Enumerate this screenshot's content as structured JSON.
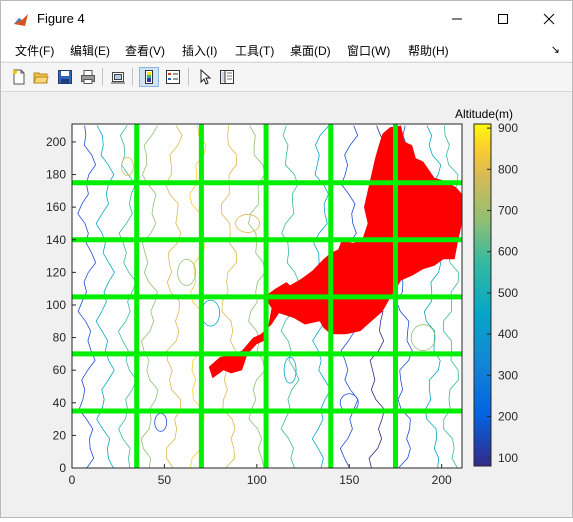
{
  "window": {
    "title": "Figure 4",
    "icon": "matlab-figure-icon"
  },
  "menu": [
    {
      "label": "文件(F)"
    },
    {
      "label": "编辑(E)"
    },
    {
      "label": "查看(V)"
    },
    {
      "label": "插入(I)"
    },
    {
      "label": "工具(T)"
    },
    {
      "label": "桌面(D)"
    },
    {
      "label": "窗口(W)"
    },
    {
      "label": "帮助(H)"
    }
  ],
  "menu_arrow": "↘",
  "toolbar": {
    "icons": [
      "new-figure-icon",
      "open-file-icon",
      "save-icon",
      "print-icon",
      "link-plot-icon",
      "colorbar-toggle-icon",
      "legend-toggle-icon",
      "edit-plot-pointer-icon",
      "property-inspector-icon"
    ],
    "active": "colorbar-toggle-icon"
  },
  "chart_data": {
    "type": "heatmap",
    "description_kind": "contour map with burned-area overlay and grid lines",
    "x_ticks": [
      "0",
      "50",
      "100",
      "150",
      "200"
    ],
    "y_ticks": [
      "0",
      "20",
      "40",
      "60",
      "80",
      "100",
      "120",
      "140",
      "160",
      "180",
      "200"
    ],
    "xlim": [
      0,
      211
    ],
    "ylim": [
      0,
      211
    ],
    "grid_lines_x": [
      35,
      70,
      105,
      140,
      175
    ],
    "grid_lines_y": [
      35,
      70,
      105,
      140,
      175
    ],
    "grid_line_color": "#00ee00",
    "fire_color": "#ff0000",
    "colorbar": {
      "title": "Altitude(m)",
      "ticks": [
        "100",
        "200",
        "300",
        "400",
        "500",
        "600",
        "700",
        "800",
        "900"
      ],
      "range": [
        80,
        910
      ],
      "colormap": "parula"
    },
    "fire_region": [
      [
        76,
        55
      ],
      [
        82,
        60
      ],
      [
        86,
        58
      ],
      [
        92,
        60
      ],
      [
        95,
        70
      ],
      [
        100,
        76
      ],
      [
        104,
        78
      ],
      [
        106,
        86
      ],
      [
        108,
        98
      ],
      [
        104,
        105
      ],
      [
        110,
        110
      ],
      [
        116,
        114
      ],
      [
        118,
        112
      ],
      [
        124,
        116
      ],
      [
        130,
        121
      ],
      [
        136,
        128
      ],
      [
        140,
        132
      ],
      [
        144,
        134
      ],
      [
        146,
        140
      ],
      [
        152,
        138
      ],
      [
        157,
        140
      ],
      [
        160,
        150
      ],
      [
        158,
        160
      ],
      [
        160,
        170
      ],
      [
        162,
        180
      ],
      [
        164,
        190
      ],
      [
        166,
        198
      ],
      [
        168,
        205
      ],
      [
        172,
        209
      ],
      [
        178,
        210
      ],
      [
        180,
        200
      ],
      [
        184,
        198
      ],
      [
        186,
        190
      ],
      [
        190,
        188
      ],
      [
        196,
        178
      ],
      [
        202,
        176
      ],
      [
        208,
        172
      ],
      [
        211,
        168
      ],
      [
        211,
        150
      ],
      [
        209,
        140
      ],
      [
        207,
        128
      ],
      [
        201,
        128
      ],
      [
        196,
        124
      ],
      [
        190,
        122
      ],
      [
        184,
        118
      ],
      [
        178,
        115
      ],
      [
        172,
        104
      ],
      [
        168,
        96
      ],
      [
        164,
        92
      ],
      [
        156,
        84
      ],
      [
        148,
        82
      ],
      [
        140,
        82
      ],
      [
        136,
        86
      ],
      [
        134,
        90
      ],
      [
        126,
        88
      ],
      [
        120,
        92
      ],
      [
        112,
        95
      ],
      [
        108,
        88
      ],
      [
        102,
        82
      ],
      [
        98,
        80
      ],
      [
        92,
        72
      ],
      [
        88,
        70
      ],
      [
        80,
        68
      ],
      [
        74,
        62
      ]
    ]
  }
}
